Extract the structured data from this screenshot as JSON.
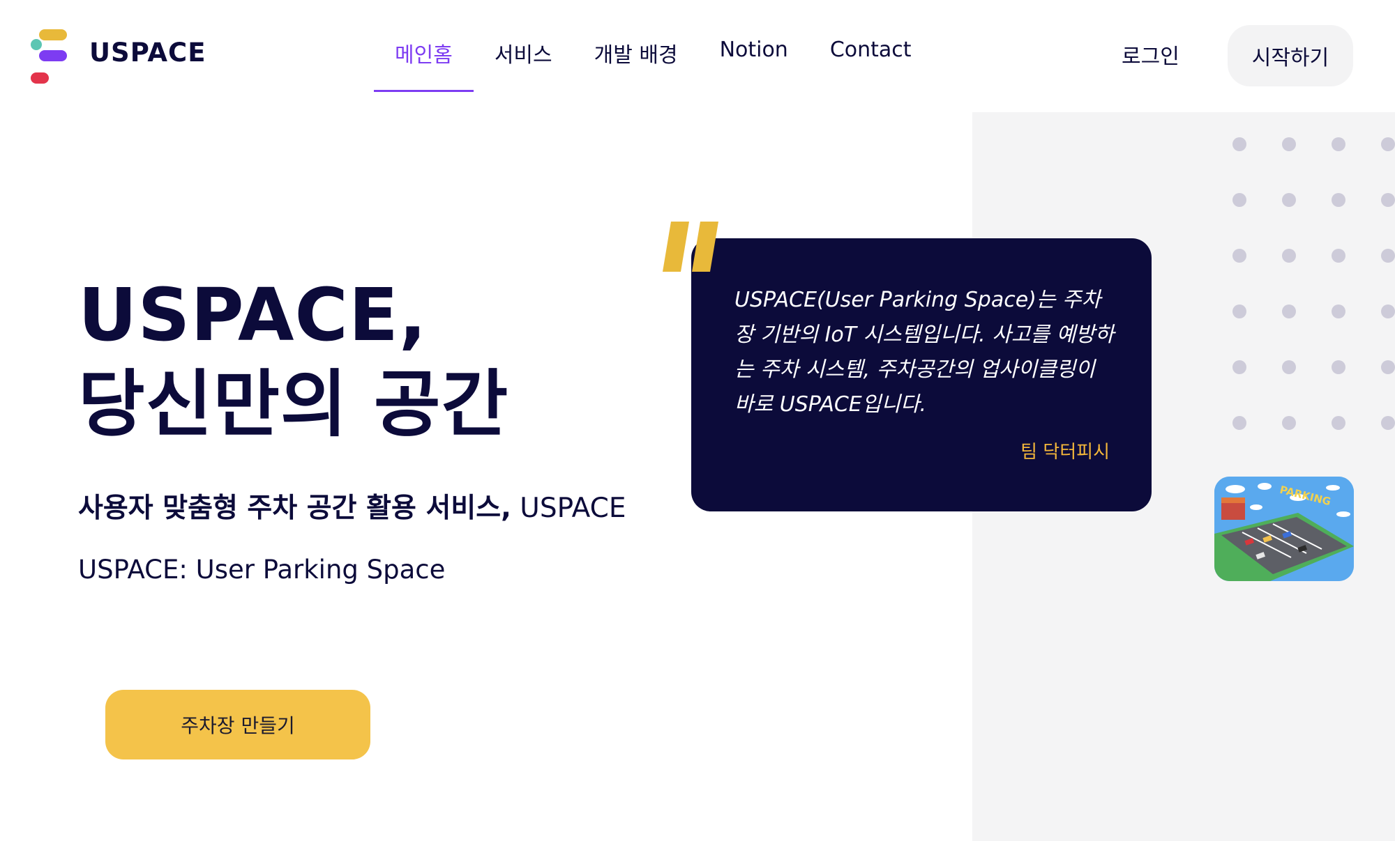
{
  "brand": {
    "name": "USPACE",
    "colors": {
      "navy": "#0c0b3a",
      "purple": "#7d3cf2",
      "yellow": "#f4c34a",
      "quote_yellow": "#e8b93a",
      "teal": "#5cc6b3",
      "red": "#e3344b",
      "panel_grey": "#f4f4f5"
    }
  },
  "nav": {
    "items": [
      {
        "label": "메인홈",
        "active": true
      },
      {
        "label": "서비스",
        "active": false
      },
      {
        "label": "개발 배경",
        "active": false
      },
      {
        "label": "Notion",
        "active": false
      },
      {
        "label": "Contact",
        "active": false
      }
    ],
    "login_label": "로그인",
    "start_label": "시작하기"
  },
  "hero": {
    "title_line1": "USPACE,",
    "title_line2": "당신만의 공간",
    "subtitle_bold": "사용자 맞춤형 주차 공간 활용 서비스,",
    "subtitle_light": " USPACE",
    "tagline": "USPACE: User Parking Space",
    "cta_label": "주차장 만들기"
  },
  "quote": {
    "mark_icon": "quote-mark-icon",
    "text": "USPACE(User Parking Space)는 주차장 기반의 IoT 시스템입니다. 사고를 예방하는 주차 시스템, 주차공간의 업사이클링이 바로 USPACE입니다.",
    "author": "팀 닥터피시"
  },
  "illustration": {
    "sign_text": "PARKING"
  }
}
